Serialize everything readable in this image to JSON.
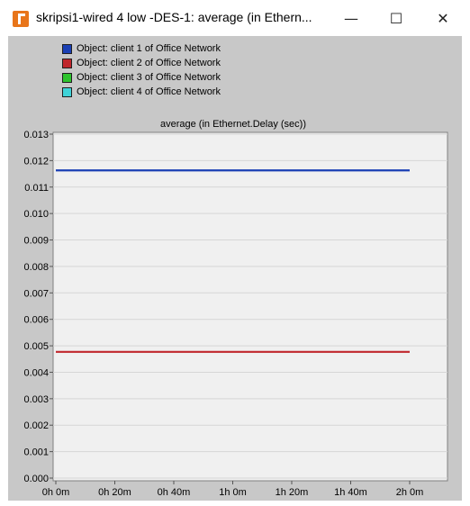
{
  "window": {
    "title": "skripsi1-wired 4 low -DES-1: average (in Ethern...",
    "minimize_icon": "minimize-icon",
    "maximize_icon": "maximize-icon",
    "close_icon": "close-icon"
  },
  "colors": {
    "client1": "#1a3fb4",
    "client2": "#c0262c",
    "client3": "#2ec42e",
    "client4": "#3fd3d8",
    "plot_bg": "#f0f0f0",
    "panel_bg": "#c8c8c8"
  },
  "legend": [
    {
      "label": "Object: client 1 of Office Network",
      "color": "#1a3fb4"
    },
    {
      "label": "Object: client 2 of Office Network",
      "color": "#c0262c"
    },
    {
      "label": "Object: client 3 of Office Network",
      "color": "#2ec42e"
    },
    {
      "label": "Object: client 4 of Office Network",
      "color": "#3fd3d8"
    }
  ],
  "chart_data": {
    "type": "line",
    "title": "average (in Ethernet.Delay (sec))",
    "xlabel": "",
    "ylabel": "",
    "x_tick_labels": [
      "0h 0m",
      "0h 20m",
      "0h 40m",
      "1h 0m",
      "1h 20m",
      "1h 40m",
      "2h 0m"
    ],
    "x_ticks_min": [
      0,
      20,
      40,
      60,
      80,
      100,
      120
    ],
    "xlim_min": [
      0,
      133
    ],
    "y_tick_labels": [
      "0.000",
      "0.001",
      "0.002",
      "0.003",
      "0.004",
      "0.005",
      "0.006",
      "0.007",
      "0.008",
      "0.009",
      "0.010",
      "0.011",
      "0.012",
      "0.013"
    ],
    "y_ticks": [
      0.0,
      0.001,
      0.002,
      0.003,
      0.004,
      0.005,
      0.006,
      0.007,
      0.008,
      0.009,
      0.01,
      0.011,
      0.012,
      0.013
    ],
    "ylim": [
      0,
      0.013
    ],
    "grid": true,
    "legend_position": "top-left",
    "series": [
      {
        "name": "Object: client 1 of Office Network",
        "color": "#1a3fb4",
        "x_min": [
          0,
          120
        ],
        "y": [
          0.01163,
          0.01163
        ]
      },
      {
        "name": "Object: client 2 of Office Network",
        "color": "#c0262c",
        "x_min": [
          0,
          120
        ],
        "y": [
          0.00477,
          0.00477
        ]
      }
    ]
  }
}
